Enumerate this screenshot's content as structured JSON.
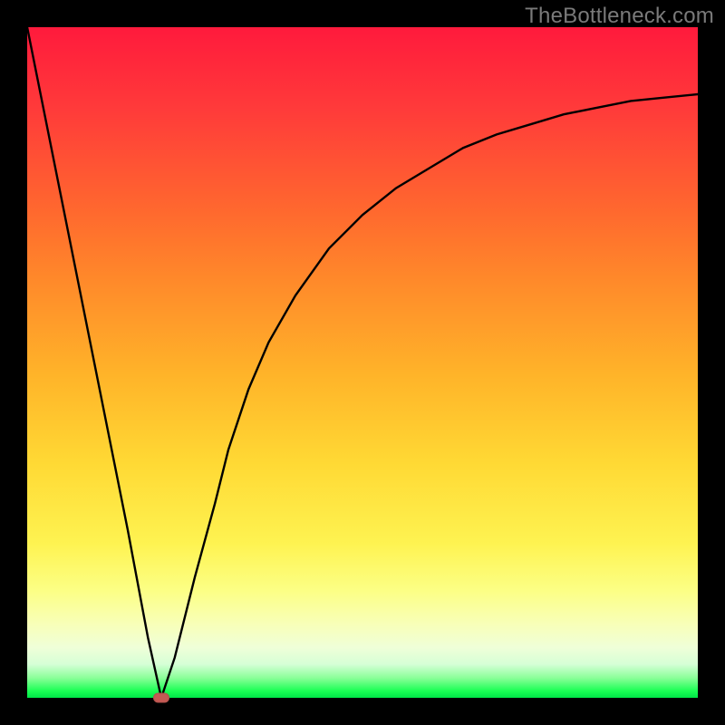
{
  "watermark": "TheBottleneck.com",
  "colors": {
    "frame": "#000000",
    "curve": "#000000",
    "marker": "#c55a54",
    "gradient_top": "#ff1a3c",
    "gradient_bottom": "#00e648"
  },
  "chart_data": {
    "type": "line",
    "title": "",
    "xlabel": "",
    "ylabel": "",
    "xlim": [
      0,
      100
    ],
    "ylim": [
      0,
      100
    ],
    "grid": false,
    "legend": false,
    "annotations": [
      {
        "name": "min-marker",
        "x": 20,
        "y": 0,
        "shape": "pill",
        "color": "#c55a54"
      }
    ],
    "series": [
      {
        "name": "bottleneck-curve",
        "x": [
          0,
          5,
          10,
          15,
          18,
          20,
          22,
          25,
          28,
          30,
          33,
          36,
          40,
          45,
          50,
          55,
          60,
          65,
          70,
          75,
          80,
          85,
          90,
          95,
          100
        ],
        "values": [
          100,
          75,
          50,
          25,
          9,
          0,
          6,
          18,
          29,
          37,
          46,
          53,
          60,
          67,
          72,
          76,
          79,
          82,
          84,
          85.5,
          87,
          88,
          89,
          89.5,
          90
        ]
      }
    ]
  }
}
